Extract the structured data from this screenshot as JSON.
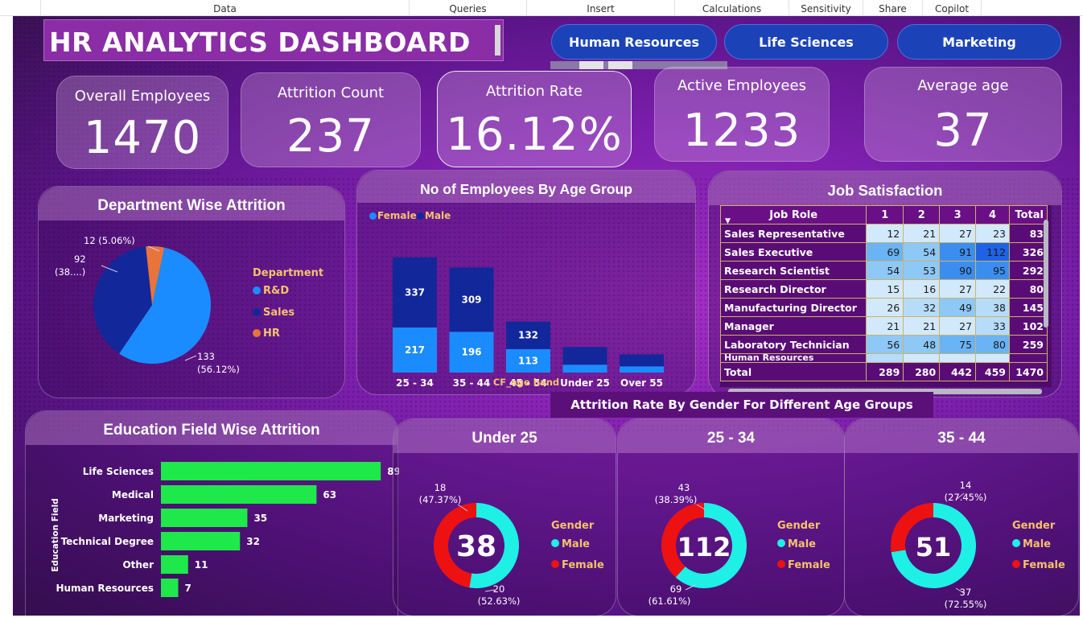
{
  "ribbon": {
    "tabs": [
      "Data",
      "Queries",
      "Insert",
      "Calculations",
      "Sensitivity",
      "Share",
      "Copilot"
    ]
  },
  "dashboard": {
    "title": "HR ANALYTICS DASHBOARD",
    "filters": [
      "Human Resources",
      "Life Sciences",
      "Marketing"
    ]
  },
  "kpis": {
    "overall": {
      "label": "Overall Employees",
      "value": "1470"
    },
    "attrition_count": {
      "label": "Attrition Count",
      "value": "237"
    },
    "attrition_rate": {
      "label": "Attrition Rate",
      "value": "16.12%"
    },
    "active": {
      "label": "Active Employees",
      "value": "1233"
    },
    "avg_age": {
      "label": "Average age",
      "value": "37"
    }
  },
  "dept": {
    "title": "Department Wise Attrition",
    "legend_title": "Department",
    "labels": {
      "rd": [
        "133",
        "(56.12%)"
      ],
      "sales": [
        "92",
        "(38....)"
      ],
      "hr": [
        "12 (5.06%)"
      ]
    }
  },
  "age_group": {
    "title": "No of Employees By Age Group",
    "legend": [
      "Female",
      "Male"
    ],
    "xlabel": "CF_age band"
  },
  "job": {
    "title": "Job Satisfaction",
    "header": [
      "Job Role",
      "1",
      "2",
      "3",
      "4",
      "Total"
    ],
    "rows": [
      [
        "Sales Representative",
        "12",
        "21",
        "27",
        "23",
        "83"
      ],
      [
        "Sales Executive",
        "69",
        "54",
        "91",
        "112",
        "326"
      ],
      [
        "Research Scientist",
        "54",
        "53",
        "90",
        "95",
        "292"
      ],
      [
        "Research Director",
        "15",
        "16",
        "27",
        "22",
        "80"
      ],
      [
        "Manufacturing Director",
        "26",
        "32",
        "49",
        "38",
        "145"
      ],
      [
        "Manager",
        "21",
        "21",
        "27",
        "33",
        "102"
      ],
      [
        "Laboratory Technician",
        "56",
        "48",
        "75",
        "80",
        "259"
      ]
    ],
    "partial_row": "Human Resources",
    "total": [
      "Total",
      "289",
      "280",
      "442",
      "459",
      "1470"
    ]
  },
  "edu": {
    "title": "Education Field Wise Attrition",
    "ylabel": "Education Field"
  },
  "gender": {
    "title": "Attrition Rate By Gender For Different Age Groups",
    "legend_title": "Gender",
    "legend": [
      "Male",
      "Female"
    ],
    "donuts": [
      {
        "title": "Under 25",
        "center": "38",
        "female_label": [
          "18",
          "(47.37%)"
        ],
        "male_label": [
          "20",
          "(52.63%)"
        ]
      },
      {
        "title": "25 - 34",
        "center": "112",
        "female_label": [
          "43",
          "(38.39%)"
        ],
        "male_label": [
          "69",
          "(61.61%)"
        ]
      },
      {
        "title": "35 - 44",
        "center": "51",
        "female_label": [
          "14",
          "(27.45%)"
        ],
        "male_label": [
          "37",
          "(72.55%)"
        ]
      }
    ]
  },
  "colors": {
    "rd": "#1a8cff",
    "sales": "#12279a",
    "hr": "#e8743b",
    "female_bar": "#1a8cff",
    "male_bar": "#12279a",
    "edu_bar": "#1ee84a",
    "donut_male": "#1ef0e6",
    "donut_female": "#ee1111",
    "gold": "#f5c26b"
  },
  "chart_data": [
    {
      "type": "pie",
      "title": "Department Wise Attrition",
      "categories": [
        "R&D",
        "Sales",
        "HR"
      ],
      "values": [
        133,
        92,
        12
      ]
    },
    {
      "type": "bar",
      "title": "No of Employees By Age Group",
      "xlabel": "CF_age band",
      "categories": [
        "25 - 34",
        "35 - 44",
        "45 - 54",
        "Under 25",
        "Over 55"
      ],
      "series": [
        {
          "name": "Female",
          "values": [
            217,
            196,
            113,
            38,
            30
          ]
        },
        {
          "name": "Male",
          "values": [
            337,
            309,
            132,
            85,
            57
          ]
        }
      ],
      "stacked": true
    },
    {
      "type": "bar",
      "orientation": "horizontal",
      "title": "Education Field Wise Attrition",
      "ylabel": "Education Field",
      "categories": [
        "Life Sciences",
        "Medical",
        "Marketing",
        "Technical Degree",
        "Other",
        "Human Resources"
      ],
      "values": [
        89,
        63,
        35,
        32,
        11,
        7
      ]
    },
    {
      "type": "pie",
      "title": "Under 25",
      "categories": [
        "Male",
        "Female"
      ],
      "values": [
        20,
        18
      ]
    },
    {
      "type": "pie",
      "title": "25 - 34",
      "categories": [
        "Male",
        "Female"
      ],
      "values": [
        69,
        43
      ]
    },
    {
      "type": "pie",
      "title": "35 - 44",
      "categories": [
        "Male",
        "Female"
      ],
      "values": [
        37,
        14
      ]
    }
  ]
}
